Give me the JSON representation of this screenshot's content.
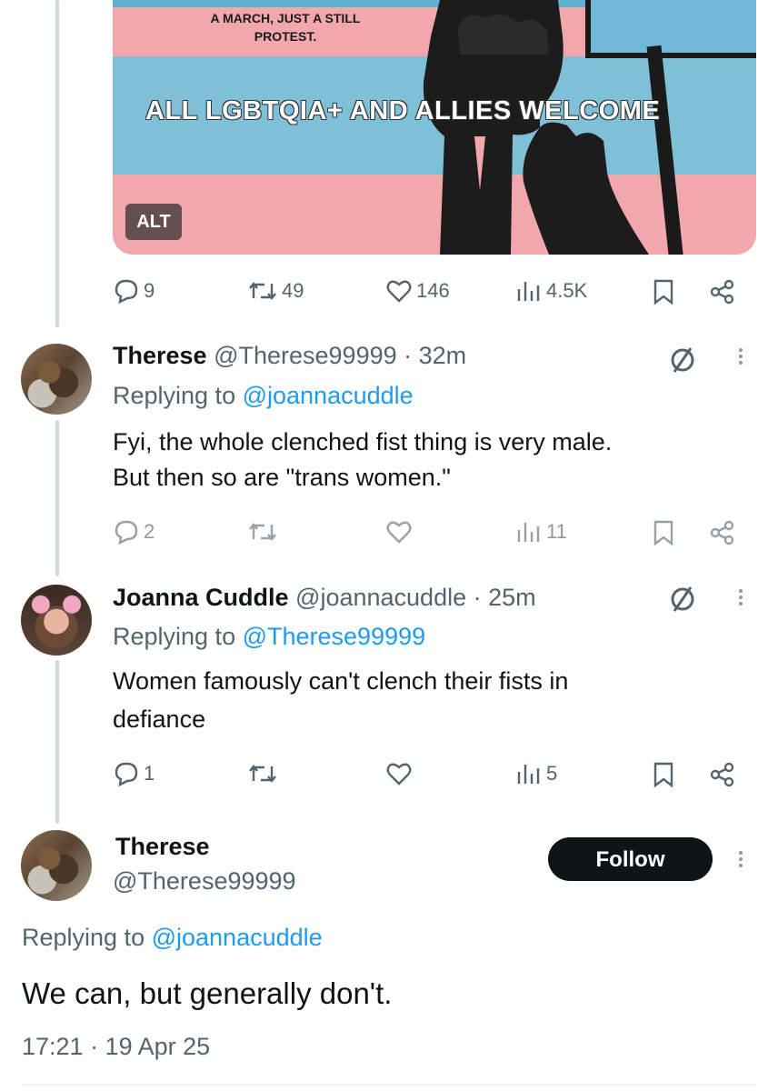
{
  "image_card": {
    "top_text": "A MARCH, JUST A STILL PROTEST.",
    "banner_text": "ALL LGBTQIA+ AND ALLIES WELCOME",
    "alt_badge": "ALT"
  },
  "main_actions": {
    "replies": "9",
    "reposts": "49",
    "likes": "146",
    "views": "4.5K"
  },
  "reply1": {
    "name": "Therese",
    "handle": "@Therese99999",
    "time": "· 32m",
    "replying_prefix": "Replying to ",
    "replying_to": "@joannacuddle",
    "text_line1": "Fyi, the whole clenched fist thing is very male.",
    "text_line2": "But then so are \"trans women.\"",
    "actions": {
      "replies": "2",
      "views": "11"
    }
  },
  "reply2": {
    "name": "Joanna Cuddle",
    "handle": "@joannacuddle",
    "time": "· 25m",
    "replying_prefix": "Replying to ",
    "replying_to": "@Therese99999",
    "text_line1": "Women famously can't clench their fists in",
    "text_line2": "defiance",
    "actions": {
      "replies": "1",
      "views": "5"
    }
  },
  "focus_tweet": {
    "name": "Therese",
    "handle": "@Therese99999",
    "follow_label": "Follow",
    "replying_prefix": "Replying to ",
    "replying_to": "@joannacuddle",
    "text": "We can, but generally don't.",
    "timestamp": "17:21 · 19 Apr 25"
  }
}
